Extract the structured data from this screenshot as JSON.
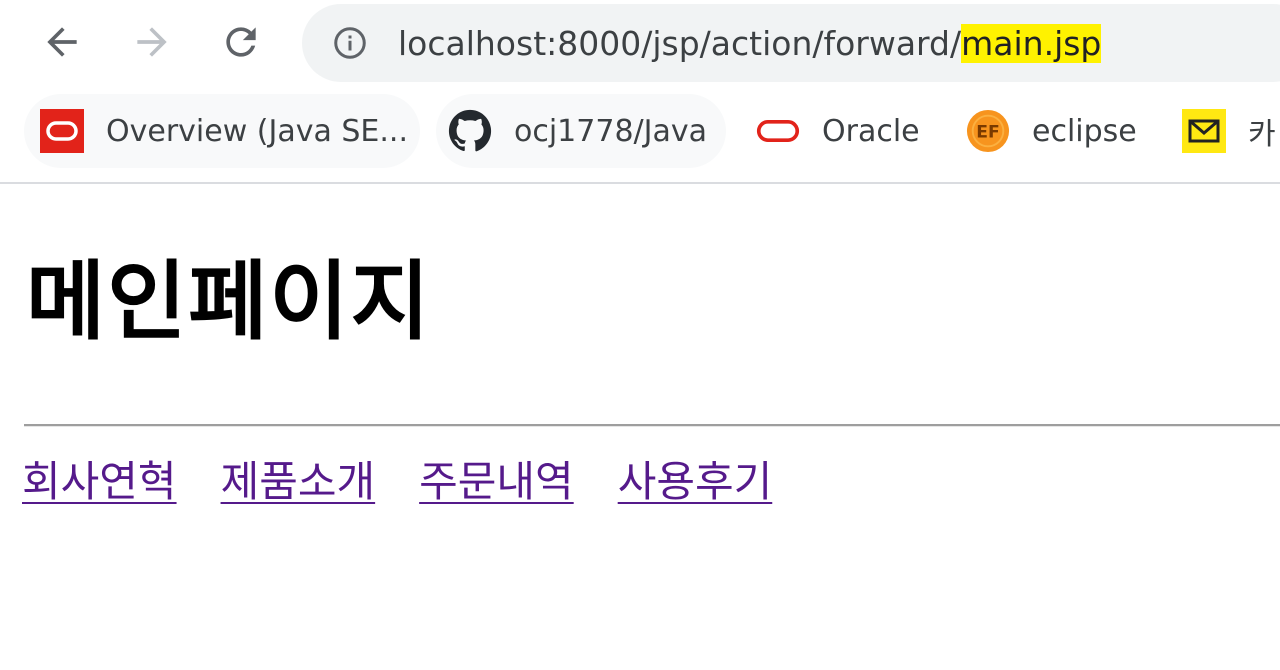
{
  "browser": {
    "url": {
      "prefix": "localhost:8000/jsp/action/forward/",
      "highlighted": "main.jsp"
    },
    "bookmarks": [
      {
        "label": "Overview (Java SE...",
        "icon": "oracle-icon"
      },
      {
        "label": "ocj1778/Java",
        "icon": "github-icon"
      },
      {
        "label": "Oracle",
        "icon": "oracle-outline-icon"
      },
      {
        "label": "eclipse",
        "icon": "eclipse-icon"
      },
      {
        "label": "카",
        "icon": "mail-icon"
      }
    ],
    "colors": {
      "url_highlight": "#fff200",
      "visited_link": "#551a8b",
      "oracle_red": "#e2231a",
      "eclipse_orange": "#f7941e",
      "mail_yellow": "#ffe812"
    }
  },
  "page": {
    "title": "메인페이지",
    "links": [
      "회사연혁",
      "제품소개",
      "주문내역",
      "사용후기"
    ]
  }
}
